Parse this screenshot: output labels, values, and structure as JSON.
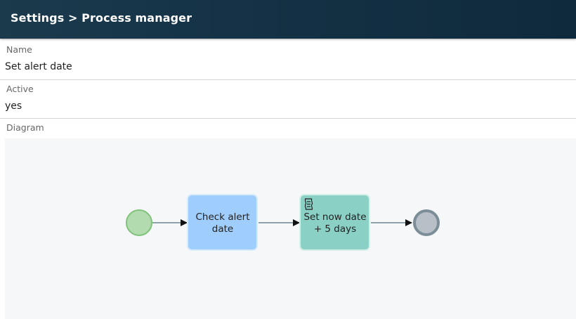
{
  "header": {
    "breadcrumb": "Settings > Process manager"
  },
  "form": {
    "name": {
      "label": "Name",
      "value": "Set alert date"
    },
    "active": {
      "label": "Active",
      "value": "yes"
    },
    "diagram": {
      "label": "Diagram"
    }
  },
  "diagram": {
    "start_event_color": "#b3dbb0",
    "end_event_color": "#b7c0c6",
    "tasks": [
      {
        "line1": "Check alert",
        "line2": "date",
        "color": "#9fcdfc"
      },
      {
        "line1": "Set now date",
        "line2": "+ 5 days",
        "color": "#8ad0c5",
        "icon": "script-icon"
      }
    ]
  }
}
